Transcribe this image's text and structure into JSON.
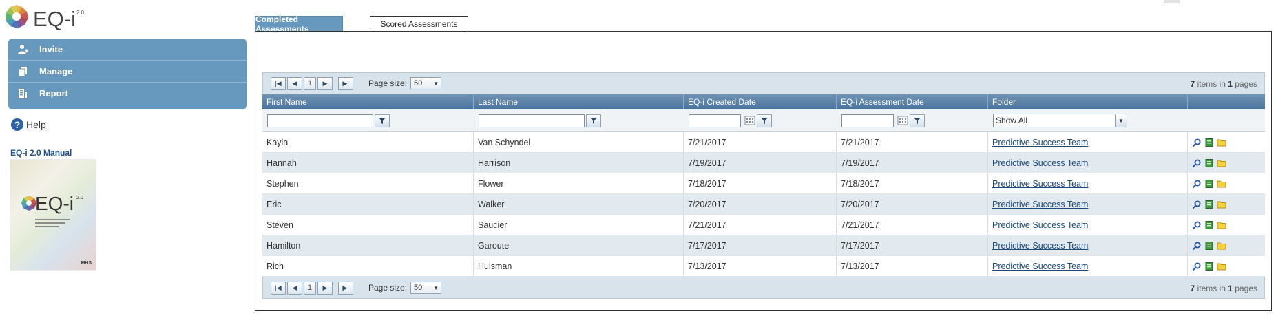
{
  "brand": {
    "logo_text": "EQ-i",
    "logo_sup": "2.0"
  },
  "sidebar": {
    "nav": [
      {
        "label": "Invite",
        "icon": "user-add-icon"
      },
      {
        "label": "Manage",
        "icon": "documents-icon"
      },
      {
        "label": "Report",
        "icon": "report-icon"
      }
    ],
    "help_label": "Help",
    "manual_title": "EQ-i 2.0 Manual",
    "manual_cover": {
      "logo_text": "EQ-i",
      "logo_sup": "2.0",
      "brand": "MHS"
    }
  },
  "tabs": [
    {
      "label": "Completed Assessments",
      "active": true
    },
    {
      "label": "Scored Assessments",
      "active": false
    }
  ],
  "grid": {
    "pager": {
      "current_page": "1",
      "page_size_label": "Page size:",
      "page_size": "50",
      "item_count": "7",
      "page_count": "1",
      "items_in_text": "items in",
      "pages_text": "pages"
    },
    "columns": [
      "First Name",
      "Last Name",
      "EQ-i Created Date",
      "EQ-i Assessment Date",
      "Folder",
      ""
    ],
    "folder_filter": "Show All",
    "rows": [
      {
        "first": "Kayla",
        "last": "Van Schyndel",
        "created": "7/21/2017",
        "assessed": "7/21/2017",
        "folder": "Predictive Success Team"
      },
      {
        "first": "Hannah",
        "last": "Harrison",
        "created": "7/19/2017",
        "assessed": "7/19/2017",
        "folder": "Predictive Success Team"
      },
      {
        "first": "Stephen",
        "last": "Flower",
        "created": "7/18/2017",
        "assessed": "7/18/2017",
        "folder": "Predictive Success Team"
      },
      {
        "first": "Eric",
        "last": "Walker",
        "created": "7/20/2017",
        "assessed": "7/20/2017",
        "folder": "Predictive Success Team"
      },
      {
        "first": "Steven",
        "last": "Saucier",
        "created": "7/21/2017",
        "assessed": "7/21/2017",
        "folder": "Predictive Success Team"
      },
      {
        "first": "Hamilton",
        "last": "Garoute",
        "created": "7/17/2017",
        "assessed": "7/17/2017",
        "folder": "Predictive Success Team"
      },
      {
        "first": "Rich",
        "last": "Huisman",
        "created": "7/13/2017",
        "assessed": "7/13/2017",
        "folder": "Predictive Success Team"
      }
    ],
    "row_actions": [
      "view-icon",
      "report-sheet-icon",
      "folder-icon"
    ]
  },
  "colors": {
    "accent": "#6699bd",
    "header": "#5a81a7",
    "link": "#1a4a7e",
    "alt_row": "#e2e9ef"
  }
}
